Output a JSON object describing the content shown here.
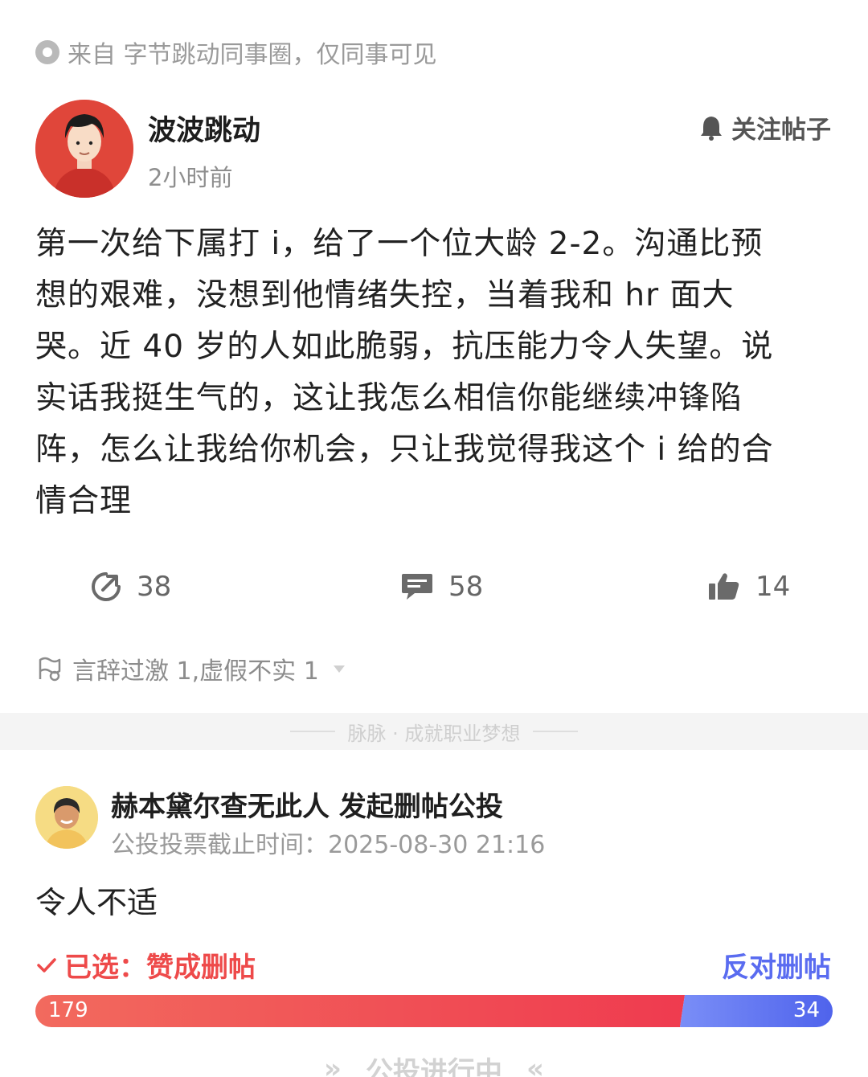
{
  "source": {
    "text": "来自 字节跳动同事圈，仅同事可见",
    "icon": "circle-dot-icon"
  },
  "author": {
    "name": "波波跳动",
    "time": "2小时前",
    "follow_label": "关注帖子"
  },
  "post": {
    "lines": [
      "第一次给下属打 i，给了一个位大龄 2-2。沟通比预",
      "想的艰难，没想到他情绪失控，当着我和 hr 面大",
      "哭。近 40 岁的人如此脆弱，抗压能力令人失望。说",
      "实话我挺生气的，这让我怎么相信你能继续冲锋陷",
      "阵，怎么让我给你机会，只让我觉得我这个 i 给的合",
      "情合理"
    ]
  },
  "actions": {
    "share": "38",
    "comment": "58",
    "like": "14"
  },
  "report": {
    "text": "言辞过激 1,虚假不实 1"
  },
  "divider": {
    "text": "脉脉 · 成就职业梦想"
  },
  "vote": {
    "title": "赫本黛尔查无此人 发起删帖公投",
    "deadline": "公投投票截止时间：2025-08-30 21:16",
    "reason": "令人不适",
    "selected_label": "已选：赞成删帖",
    "oppose_label": "反对删帖",
    "for_count": "179",
    "against_count": "34",
    "for_fraction": 0.81,
    "status": "公投进行中"
  },
  "colors": {
    "accent_red": "#ee4a4a",
    "accent_blue": "#5a6cf0"
  }
}
